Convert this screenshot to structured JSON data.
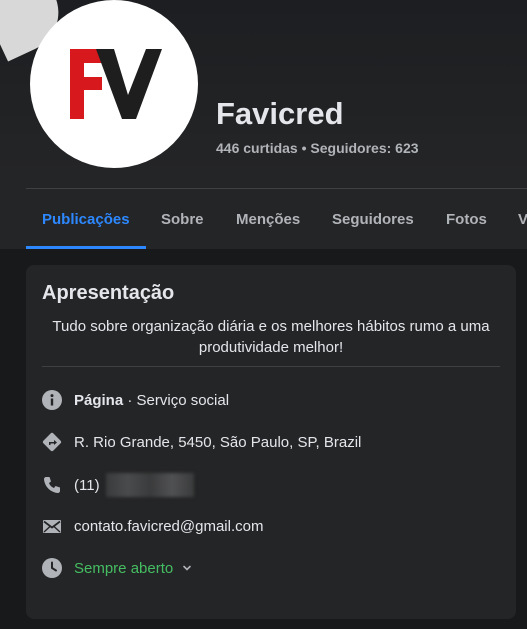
{
  "page": {
    "name": "Favicred",
    "stats": "446 curtidas • Seguidores: 623",
    "logo_text": "FV"
  },
  "tabs": [
    {
      "label": "Publicações",
      "active": true
    },
    {
      "label": "Sobre"
    },
    {
      "label": "Menções"
    },
    {
      "label": "Seguidores"
    },
    {
      "label": "Fotos"
    },
    {
      "label": "V"
    }
  ],
  "intro": {
    "title": "Apresentação",
    "bio": "Tudo sobre organização diária e os melhores hábitos rumo a uma produtividade melhor!",
    "category_label": "Página",
    "category_value": " · Serviço social",
    "address": "R. Rio Grande, 5450, São Paulo, SP, Brazil",
    "phone_prefix": "(11)",
    "email": "contato.favicred@gmail.com",
    "hours": "Sempre aberto"
  },
  "colors": {
    "accent": "#2d88ff",
    "open_status": "#45bd62",
    "logo_red": "#d7191e",
    "logo_dark": "#1e1e1e"
  }
}
